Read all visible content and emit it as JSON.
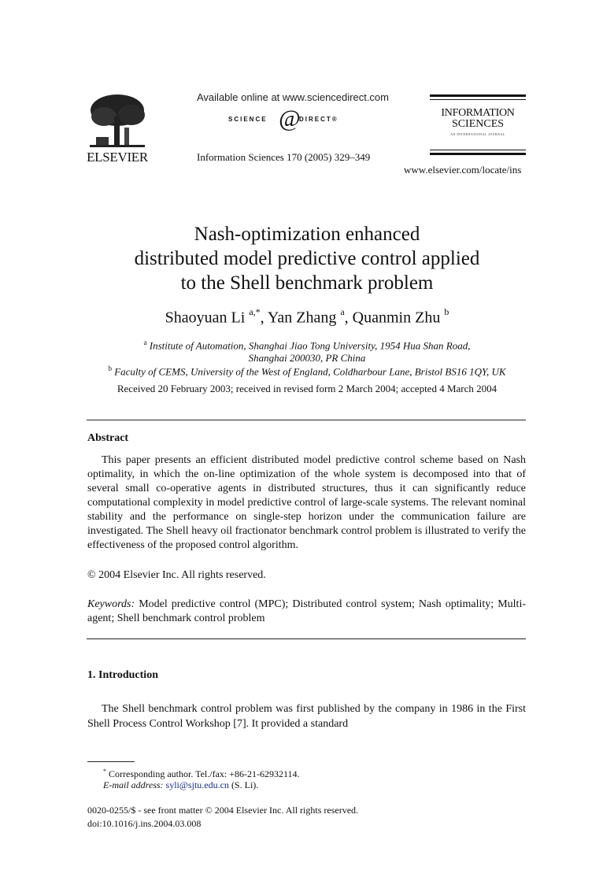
{
  "header": {
    "publisher": "ELSEVIER",
    "available_online": "Available online at www.sciencedirect.com",
    "sciencedirect_left": "SCIENCE",
    "sciencedirect_at": "d",
    "sciencedirect_right": "DIRECT®",
    "journal_ref": "Information Sciences 170 (2005) 329–349",
    "journal_logo_line1": "INFORMATION",
    "journal_logo_line2": "SCIENCES",
    "journal_logo_line3": "AN INTERNATIONAL JOURNAL",
    "locate_url": "www.elsevier.com/locate/ins"
  },
  "article": {
    "title_lines": [
      "Nash-optimization enhanced",
      "distributed model predictive control applied",
      "to the Shell benchmark problem"
    ],
    "authors": [
      {
        "name": "Shaoyuan Li",
        "sup": "a,*"
      },
      {
        "name": "Yan Zhang",
        "sup": "a"
      },
      {
        "name": "Quanmin Zhu",
        "sup": "b"
      }
    ],
    "affiliations": [
      {
        "mark": "a",
        "line1": "Institute of Automation, Shanghai Jiao Tong University, 1954 Hua Shan Road,",
        "line2": "Shanghai 200030, PR China"
      },
      {
        "mark": "b",
        "line1": "Faculty of CEMS, University of the West of England, Coldharbour Lane, Bristol BS16 1QY, UK"
      }
    ],
    "received": "Received 20 February 2003; received in revised form 2 March 2004; accepted 4 March 2004"
  },
  "abstract": {
    "heading": "Abstract",
    "body": "This paper presents an efficient distributed model predictive control scheme based on Nash optimality, in which the on-line optimization of the whole system is decomposed into that of several small co-operative agents in distributed structures, thus it can significantly reduce computational complexity in model predictive control of large-scale systems. The relevant nominal stability and the performance on single-step horizon under the communication failure are investigated. The Shell heavy oil fractionator benchmark control problem is illustrated to verify the effectiveness of the proposed control algorithm.",
    "copyright": "© 2004 Elsevier Inc. All rights reserved.",
    "keywords_label": "Keywords:",
    "keywords": "Model predictive control (MPC); Distributed control system; Nash optimality; Multi-agent; Shell benchmark control problem"
  },
  "introduction": {
    "heading": "1. Introduction",
    "body": "The Shell benchmark control problem was first published by the company in 1986 in the First Shell Process Control Workshop [7]. It provided a standard"
  },
  "footnotes": {
    "corresponding_mark": "*",
    "corresponding": "Corresponding author. Tel./fax: +86-21-62932114.",
    "email_label": "E-mail address:",
    "email": "syli@sjtu.edu.cn",
    "email_suffix": "(S. Li).",
    "front_matter": "0020-0255/$ - see front matter © 2004 Elsevier Inc. All rights reserved.",
    "doi": "doi:10.1016/j.ins.2004.03.008"
  },
  "colors": {
    "link": "#1a2a8a",
    "text": "#111111"
  }
}
